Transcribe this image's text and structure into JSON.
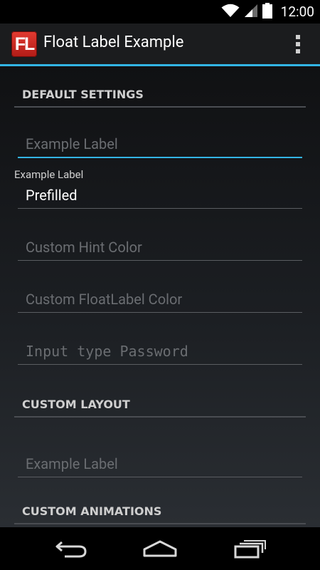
{
  "status_bar": {
    "time": "12:00",
    "icons": [
      "wifi-icon",
      "signal-icon",
      "battery-icon"
    ]
  },
  "action_bar": {
    "logo_text": "FL",
    "title": "Float Label Example",
    "overflow_icon": "overflow-menu-icon",
    "accent_color": "#33b5e5"
  },
  "sections": {
    "default_settings": {
      "header": "DEFAULT SETTINGS",
      "fields": {
        "example_label": {
          "hint": "Example Label"
        },
        "prefilled": {
          "float_label": "Example Label",
          "value": "Prefilled"
        },
        "custom_hint_color": {
          "hint": "Custom Hint Color"
        },
        "custom_floatlabel_color": {
          "hint": "Custom FloatLabel Color"
        },
        "password": {
          "hint": "Input type Password"
        }
      }
    },
    "custom_layout": {
      "header": "CUSTOM LAYOUT",
      "fields": {
        "example_label": {
          "hint": "Example Label"
        }
      }
    },
    "custom_animations": {
      "header": "CUSTOM ANIMATIONS"
    }
  },
  "nav_bar": {
    "buttons": [
      "back-icon",
      "home-icon",
      "recents-icon"
    ]
  }
}
